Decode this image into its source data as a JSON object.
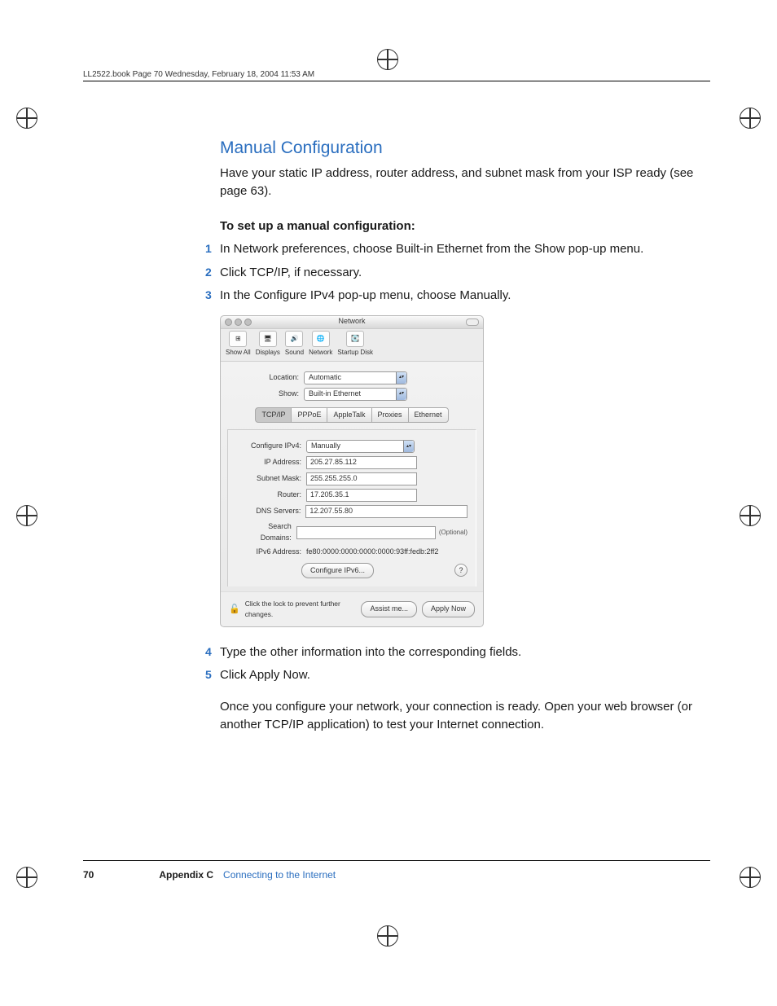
{
  "header": "LL2522.book  Page 70  Wednesday, February 18, 2004  11:53 AM",
  "heading": "Manual Configuration",
  "intro": "Have your static IP address, router address, and subnet mask from your ISP ready (see page 63).",
  "subheading": "To set up a manual configuration:",
  "steps": [
    "In Network preferences, choose Built-in Ethernet from the Show pop-up menu.",
    "Click TCP/IP, if necessary.",
    "In the Configure IPv4 pop-up menu, choose Manually."
  ],
  "steps2": [
    "Type the other information into the corresponding fields.",
    "Click Apply Now."
  ],
  "after": "Once you configure your network, your connection is ready. Open your web browser (or another TCP/IP application) to test your Internet connection.",
  "dialog": {
    "title": "Network",
    "toolbar": [
      "Show All",
      "Displays",
      "Sound",
      "Network",
      "Startup Disk"
    ],
    "locationLabel": "Location:",
    "locationValue": "Automatic",
    "showLabel": "Show:",
    "showValue": "Built-in Ethernet",
    "tabs": [
      "TCP/IP",
      "PPPoE",
      "AppleTalk",
      "Proxies",
      "Ethernet"
    ],
    "configLabel": "Configure IPv4:",
    "configValue": "Manually",
    "fields": {
      "ipLabel": "IP Address:",
      "ip": "205.27.85.112",
      "subnetLabel": "Subnet Mask:",
      "subnet": "255.255.255.0",
      "routerLabel": "Router:",
      "router": "17.205.35.1",
      "dnsLabel": "DNS Servers:",
      "dns": "12.207.55.80",
      "searchLabel": "Search Domains:",
      "search": "",
      "optional": "(Optional)",
      "ipv6Label": "IPv6 Address:",
      "ipv6": "fe80:0000:0000:0000:0000:93ff:fedb:2ff2"
    },
    "configureIPv6": "Configure IPv6...",
    "lockText": "Click the lock to prevent further changes.",
    "assist": "Assist me...",
    "apply": "Apply Now"
  },
  "footer": {
    "page": "70",
    "appendix": "Appendix C",
    "chapter": "Connecting to the Internet"
  }
}
